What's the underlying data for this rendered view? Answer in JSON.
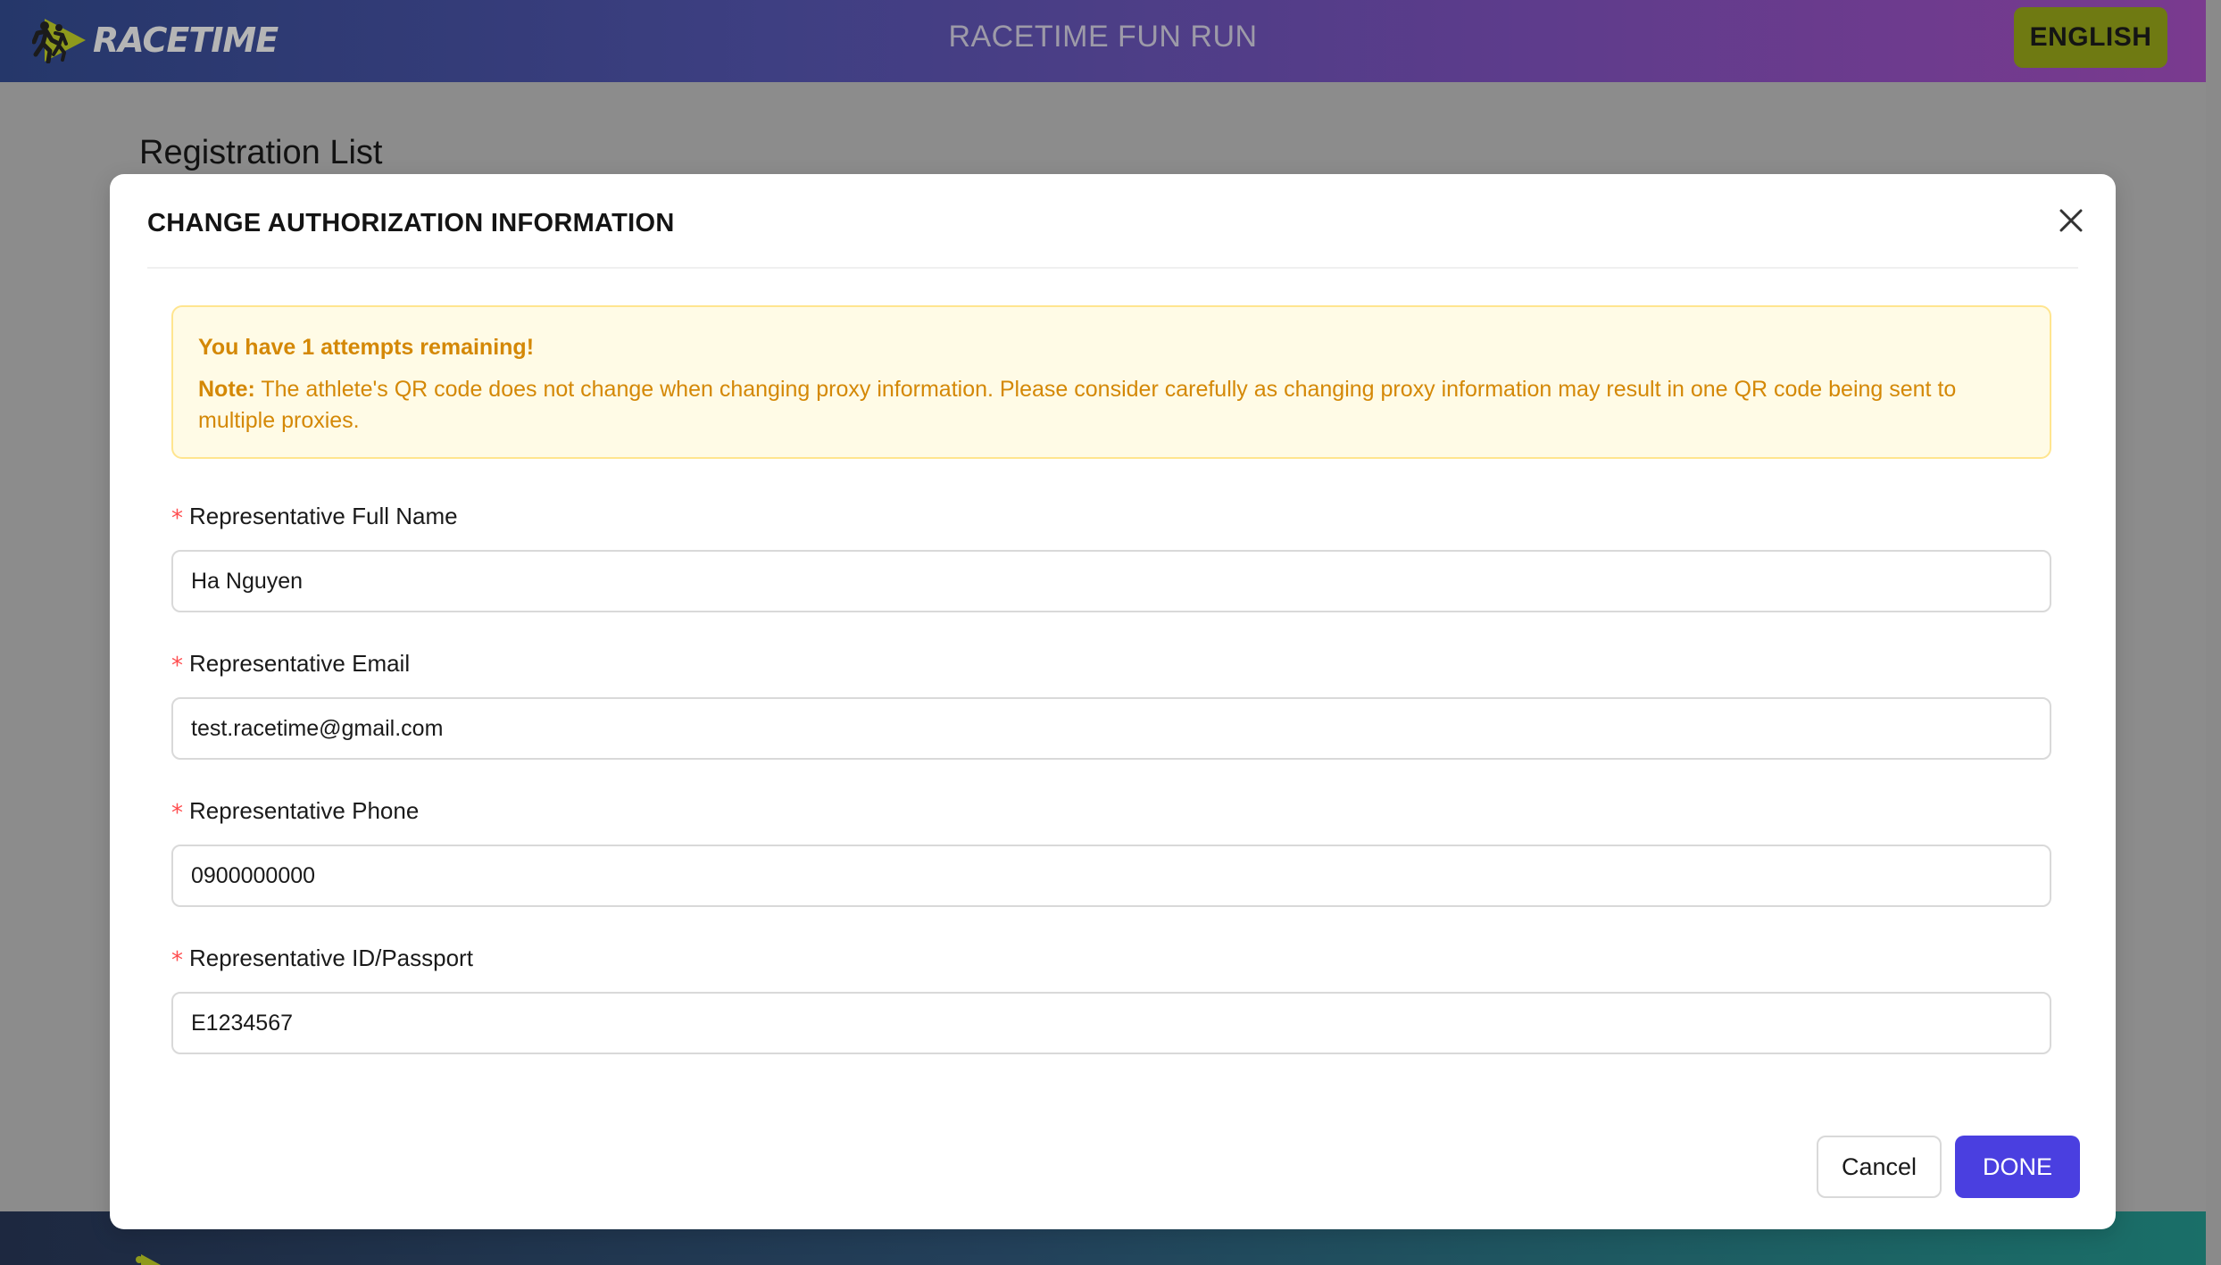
{
  "header": {
    "logo_text": "RACETIME",
    "title": "RACETIME FUN RUN",
    "language_button": "ENGLISH"
  },
  "page": {
    "heading": "Registration List"
  },
  "modal": {
    "title": "CHANGE AUTHORIZATION INFORMATION",
    "alert": {
      "heading": "You have 1 attempts remaining!",
      "note_label": "Note:",
      "note_text": " The athlete's QR code does not change when changing proxy information. Please consider carefully as changing proxy information may result in one QR code being sent to multiple proxies."
    },
    "fields": [
      {
        "label": "Representative Full Name",
        "value": "Ha Nguyen",
        "required_mark": "*"
      },
      {
        "label": "Representative Email",
        "value": "test.racetime@gmail.com",
        "required_mark": "*"
      },
      {
        "label": "Representative Phone",
        "value": "0900000000",
        "required_mark": "*"
      },
      {
        "label": "Representative ID/Passport",
        "value": "E1234567",
        "required_mark": "*"
      }
    ],
    "cancel_label": "Cancel",
    "done_label": "DONE"
  },
  "colors": {
    "primary": "#4a3fe0",
    "warning_text": "#d48806",
    "warning_bg": "#fffbe6",
    "warning_border": "#ffe58f",
    "required": "#ff4d4f",
    "language_button": "#6f7a12"
  },
  "icons": {
    "logo": "runner-play-logo-icon",
    "close": "close-icon"
  }
}
